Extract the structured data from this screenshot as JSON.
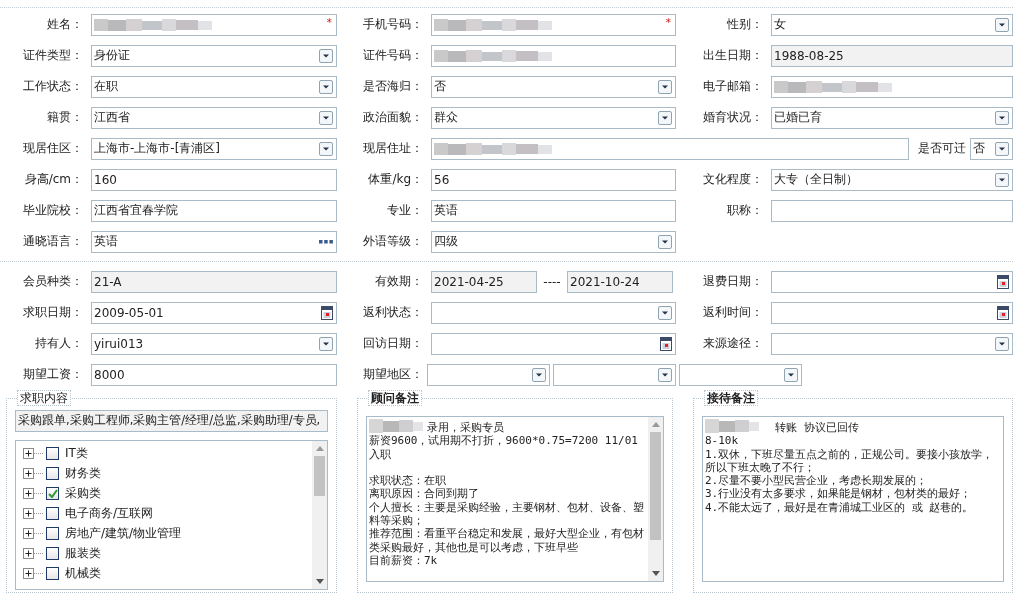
{
  "personal": {
    "rows": [
      [
        {
          "label": "姓名：",
          "kind": "redacted",
          "marker": "*"
        },
        {
          "label": "手机号码：",
          "kind": "redacted",
          "marker": "*"
        },
        {
          "label": "性别：",
          "kind": "select",
          "value": "女"
        }
      ],
      [
        {
          "label": "证件类型：",
          "kind": "select",
          "value": "身份证"
        },
        {
          "label": "证件号码：",
          "kind": "redacted"
        },
        {
          "label": "出生日期：",
          "kind": "readonly",
          "value": "1988-08-25"
        }
      ],
      [
        {
          "label": "工作状态：",
          "kind": "select",
          "value": "在职"
        },
        {
          "label": "是否海归：",
          "kind": "select",
          "value": "否"
        },
        {
          "label": "电子邮箱：",
          "kind": "redacted"
        }
      ],
      [
        {
          "label": "籍贯：",
          "kind": "select",
          "value": "江西省"
        },
        {
          "label": "政治面貌：",
          "kind": "select",
          "value": "群众"
        },
        {
          "label": "婚育状况：",
          "kind": "select",
          "value": "已婚已育"
        }
      ],
      [
        {
          "label": "现居住区：",
          "kind": "select",
          "value": "上海市-上海市-[青浦区]"
        },
        {
          "label": "现居住址：",
          "kind": "redacted"
        },
        {
          "label": "是否可迁",
          "kind": "mini-select",
          "value": "否"
        }
      ],
      [
        {
          "label": "身高/cm：",
          "kind": "text",
          "value": "160"
        },
        {
          "label": "体重/kg：",
          "kind": "text",
          "value": "56"
        },
        {
          "label": "文化程度：",
          "kind": "select",
          "value": "大专（全日制）"
        }
      ],
      [
        {
          "label": "毕业院校：",
          "kind": "text",
          "value": "江西省宜春学院"
        },
        {
          "label": "专业：",
          "kind": "text",
          "value": "英语"
        },
        {
          "label": "职称：",
          "kind": "text"
        }
      ],
      [
        {
          "label": "通晓语言：",
          "kind": "lookup",
          "value": "英语"
        },
        {
          "label": "外语等级：",
          "kind": "select",
          "value": "四级"
        }
      ]
    ]
  },
  "membership": {
    "rows": [
      [
        {
          "label": "会员种类：",
          "kind": "readonly",
          "value": "21-A"
        },
        {
          "label": "有效期：",
          "kind": "range",
          "from": "2021-04-25",
          "separator": "----",
          "to": "2021-10-24"
        },
        {
          "label": "退费日期：",
          "kind": "date"
        }
      ],
      [
        {
          "label": "求职日期：",
          "kind": "date",
          "value": "2009-05-01"
        },
        {
          "label": "返利状态：",
          "kind": "select"
        },
        {
          "label": "返利时间：",
          "kind": "date"
        }
      ],
      [
        {
          "label": "持有人：",
          "kind": "select",
          "value": "yirui013"
        },
        {
          "label": "回访日期：",
          "kind": "date"
        },
        {
          "label": "来源途径：",
          "kind": "select"
        }
      ],
      [
        {
          "label": "期望工资：",
          "kind": "text",
          "value": "8000"
        },
        {
          "label": "期望地区：",
          "kind": "multi",
          "selects": [
            {
              "kind": "select"
            },
            {
              "kind": "select"
            },
            {
              "kind": "select"
            }
          ]
        }
      ]
    ]
  },
  "job_content": {
    "title": "求职内容",
    "summary": "采购跟单,采购工程师,采购主管/经理/总监,采购助理/专员,",
    "tree": [
      {
        "label": "IT类",
        "checked": false,
        "expanded": false
      },
      {
        "label": "财务类",
        "checked": false,
        "expanded": false
      },
      {
        "label": "采购类",
        "checked": true,
        "expanded": false
      },
      {
        "label": "电子商务/互联网",
        "checked": false,
        "expanded": false
      },
      {
        "label": "房地产/建筑/物业管理",
        "checked": false,
        "expanded": false
      },
      {
        "label": "服装类",
        "checked": false,
        "expanded": false
      },
      {
        "label": "机械类",
        "checked": false,
        "expanded": false
      }
    ]
  },
  "advisor_notes": {
    "title": "顾问备注",
    "lines": [
      {
        "text": "录用，采购专员",
        "redacted": true
      },
      {
        "text": "薪资9600，试用期不打折，9600*0.75=7200   11/01入职"
      },
      {
        "text": "求职状态：在职",
        "spaced": true
      },
      {
        "text": "离职原因：合同到期了"
      },
      {
        "text": "个人擅长：主要是采购经验，主要钢材、包材、设备、塑料等采购；"
      },
      {
        "text": "推荐范围：看重平台稳定和发展，最好大型企业，有包材类采购最好，其他也是可以考虑，下班早些"
      },
      {
        "text": "目前薪资：7k"
      }
    ]
  },
  "reception_notes": {
    "title": "接待备注",
    "lines": [
      {
        "text": "转账 协议已回传",
        "redacted": true
      },
      {
        "text": "8-10k"
      },
      {
        "text": "1.双休，下班尽量五点之前的，正规公司。要接小孩放学，所以下班太晚了不行；"
      },
      {
        "text": "2.尽量不要小型民营企业，考虑长期发展的；"
      },
      {
        "text": "3.行业没有太多要求，如果能是钢材，包材类的最好；"
      },
      {
        "text": "4.不能太远了，最好是在青浦城工业区的 或 赵巷的。"
      }
    ]
  }
}
